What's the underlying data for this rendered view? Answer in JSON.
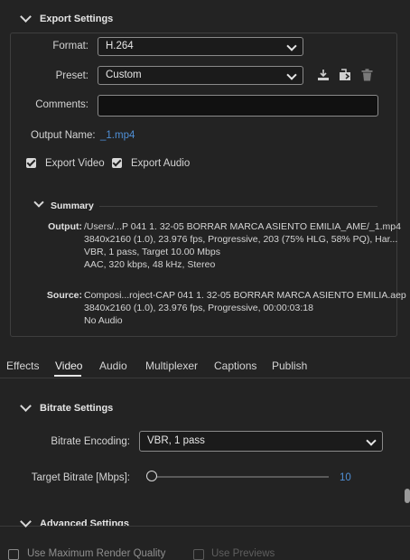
{
  "export_settings": {
    "title": "Export Settings",
    "format_label": "Format:",
    "format_value": "H.264",
    "preset_label": "Preset:",
    "preset_value": "Custom",
    "comments_label": "Comments:",
    "comments_value": "",
    "output_name_label": "Output Name:",
    "output_name_value": "_1.mp4",
    "export_video_label": "Export Video",
    "export_video_checked": true,
    "export_audio_label": "Export Audio",
    "export_audio_checked": true
  },
  "summary": {
    "title": "Summary",
    "output_key": "Output:",
    "output_lines": [
      "/Users/...P 041 1. 32-05 BORRAR MARCA ASIENTO EMILIA_AME/_1.mp4",
      "3840x2160 (1.0), 23.976 fps, Progressive, 203 (75% HLG, 58% PQ), Har...",
      "VBR, 1 pass, Target 10.00 Mbps",
      "AAC, 320 kbps, 48 kHz, Stereo"
    ],
    "source_key": "Source:",
    "source_lines": [
      "Composi...roject-CAP 041 1. 32-05 BORRAR MARCA ASIENTO EMILIA.aep",
      "3840x2160 (1.0), 23.976 fps, Progressive, 00:00:03:18",
      "No Audio"
    ]
  },
  "tabs": [
    "Effects",
    "Video",
    "Audio",
    "Multiplexer",
    "Captions",
    "Publish"
  ],
  "active_tab": "Video",
  "bitrate": {
    "title": "Bitrate Settings",
    "encoding_label": "Bitrate Encoding:",
    "encoding_value": "VBR, 1 pass",
    "target_label": "Target Bitrate [Mbps]:",
    "target_value": "10",
    "slider_fraction": 0.0
  },
  "advanced": {
    "title": "Advanced Settings",
    "use_max_render_label": "Use Maximum Render Quality",
    "use_previews_label": "Use Previews"
  },
  "icons": {
    "save_preset": "save-preset-icon",
    "import_preset": "import-preset-icon",
    "delete_preset": "trash-icon"
  },
  "colors": {
    "background": "#232323",
    "link": "#4f8fd6",
    "slider_value": "#4f8fd6"
  }
}
